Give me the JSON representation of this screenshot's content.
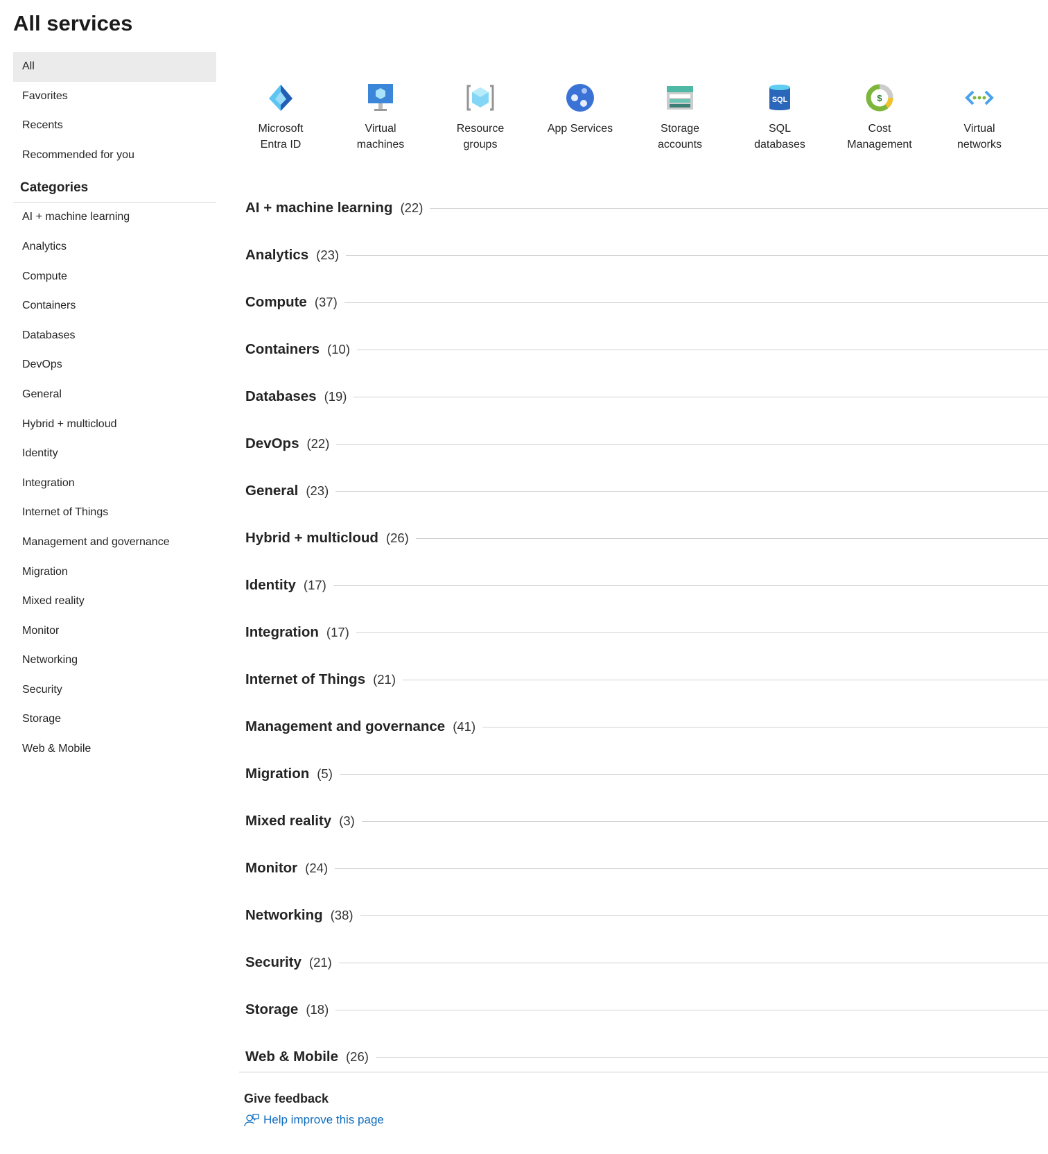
{
  "title": "All services",
  "nav": [
    {
      "label": "All"
    },
    {
      "label": "Favorites"
    },
    {
      "label": "Recents"
    },
    {
      "label": "Recommended for you"
    }
  ],
  "categories_heading": "Categories",
  "sidebar_categories": [
    "AI + machine learning",
    "Analytics",
    "Compute",
    "Containers",
    "Databases",
    "DevOps",
    "General",
    "Hybrid + multicloud",
    "Identity",
    "Integration",
    "Internet of Things",
    "Management and governance",
    "Migration",
    "Mixed reality",
    "Monitor",
    "Networking",
    "Security",
    "Storage",
    "Web & Mobile"
  ],
  "quick": [
    {
      "label": "Microsoft\nEntra ID",
      "icon": "entra-id-icon"
    },
    {
      "label": "Virtual\nmachines",
      "icon": "virtual-machine-icon"
    },
    {
      "label": "Resource\ngroups",
      "icon": "resource-group-icon"
    },
    {
      "label": "App Services",
      "icon": "app-services-icon"
    },
    {
      "label": "Storage\naccounts",
      "icon": "storage-account-icon"
    },
    {
      "label": "SQL\ndatabases",
      "icon": "sql-database-icon"
    },
    {
      "label": "Cost\nManagement",
      "icon": "cost-management-icon"
    },
    {
      "label": "Virtual\nnetworks",
      "icon": "virtual-network-icon"
    }
  ],
  "groups": [
    {
      "name": "AI + machine learning",
      "count": "(22)"
    },
    {
      "name": "Analytics",
      "count": "(23)"
    },
    {
      "name": "Compute",
      "count": "(37)"
    },
    {
      "name": "Containers",
      "count": "(10)"
    },
    {
      "name": "Databases",
      "count": "(19)"
    },
    {
      "name": "DevOps",
      "count": "(22)"
    },
    {
      "name": "General",
      "count": "(23)"
    },
    {
      "name": "Hybrid + multicloud",
      "count": "(26)"
    },
    {
      "name": "Identity",
      "count": "(17)"
    },
    {
      "name": "Integration",
      "count": "(17)"
    },
    {
      "name": "Internet of Things",
      "count": "(21)"
    },
    {
      "name": "Management and governance",
      "count": "(41)"
    },
    {
      "name": "Migration",
      "count": "(5)"
    },
    {
      "name": "Mixed reality",
      "count": "(3)"
    },
    {
      "name": "Monitor",
      "count": "(24)"
    },
    {
      "name": "Networking",
      "count": "(38)"
    },
    {
      "name": "Security",
      "count": "(21)"
    },
    {
      "name": "Storage",
      "count": "(18)"
    },
    {
      "name": "Web & Mobile",
      "count": "(26)"
    }
  ],
  "feedback": {
    "heading": "Give feedback",
    "link": "Help improve this page"
  }
}
